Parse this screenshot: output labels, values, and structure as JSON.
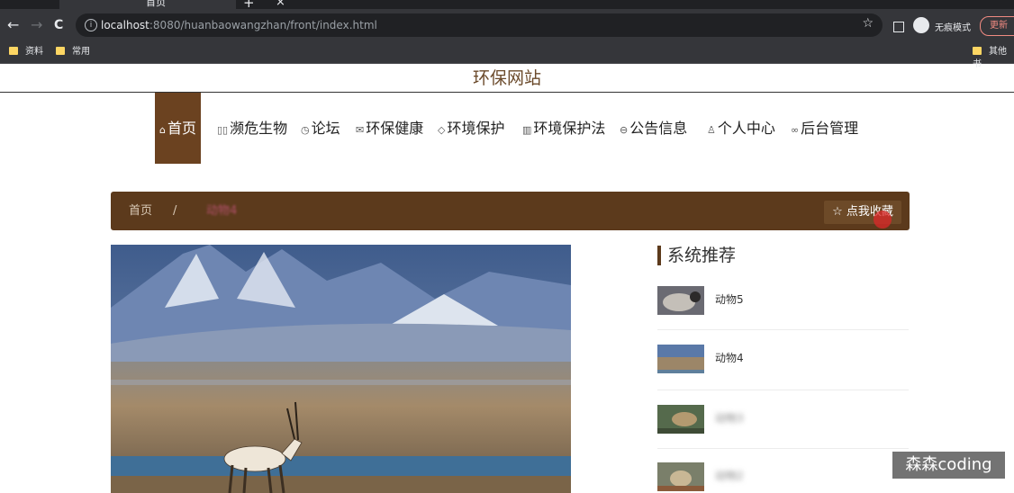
{
  "browser": {
    "tab_title": "首页",
    "tab_close": "×",
    "new_tab": "+",
    "back": "←",
    "forward": "→",
    "reload": "C",
    "url_host": "localhost",
    "url_rest": ":8080/huanbaowangzhan/front/index.html",
    "star": "☆",
    "incognito_label": "无痕模式",
    "update_label": "更新",
    "bookmarks": [
      "资料",
      "常用"
    ],
    "bookmarks_right": "其他书"
  },
  "site": {
    "title": "环保网站"
  },
  "nav": [
    {
      "icon": "⌂",
      "label": "首页",
      "active": true
    },
    {
      "icon": "▯▯",
      "label": "濒危生物"
    },
    {
      "icon": "◷",
      "label": "论坛"
    },
    {
      "icon": "✉",
      "label": "环保健康"
    },
    {
      "icon": "◇",
      "label": "环境保护"
    },
    {
      "icon": "▥",
      "label": "环境保护法"
    },
    {
      "icon": "⊖",
      "label": "公告信息"
    },
    {
      "icon": "♙",
      "label": "个人中心"
    },
    {
      "icon": "∞",
      "label": "后台管理"
    }
  ],
  "breadcrumb": {
    "home": "首页",
    "separator": "/",
    "current": "动物4",
    "favorite_button": "☆ 点我收藏"
  },
  "recommend": {
    "heading": "系统推荐",
    "items": [
      {
        "name": "动物5"
      },
      {
        "name": "动物4"
      },
      {
        "name": "动物3"
      },
      {
        "name": "动物2"
      }
    ]
  },
  "watermark": "森森coding",
  "colors": {
    "brand_brown": "#5c3a1c",
    "nav_active": "#6b4220",
    "chrome_dark": "#35363a"
  }
}
